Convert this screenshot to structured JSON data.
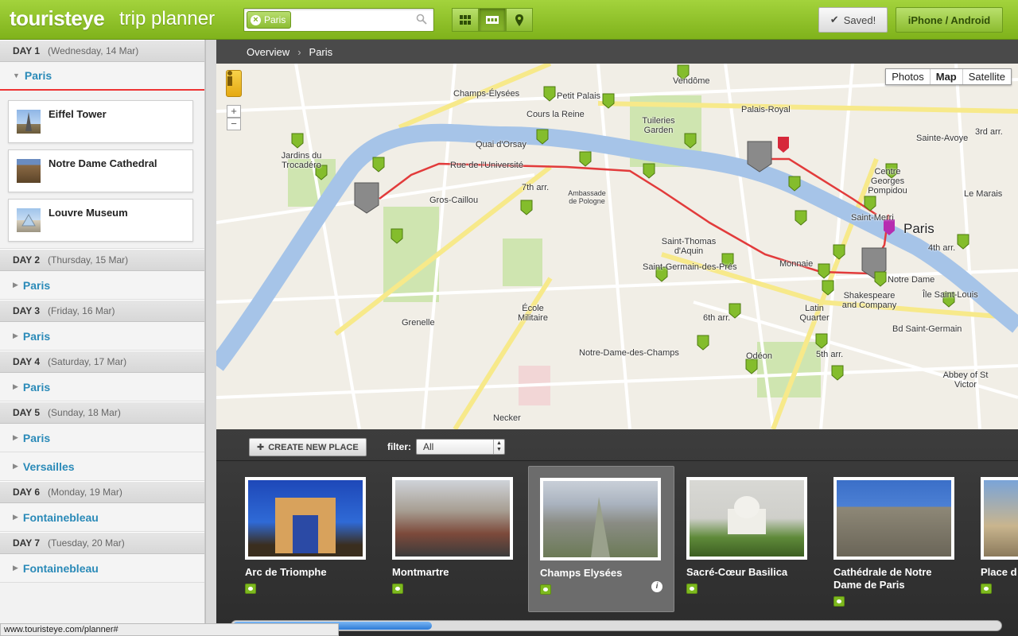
{
  "header": {
    "logo": "touristeye",
    "subtitle": "trip planner",
    "search_chip": "Paris",
    "saved_label": "Saved!",
    "platform_label": "iPhone / Android",
    "colors": {
      "brand_green": "#8cbc30",
      "link_blue": "#2a8ab8",
      "route_red": "#e23b3b"
    }
  },
  "sidebar": {
    "days": [
      {
        "label": "DAY 1",
        "date": "(Wednesday, 14 Mar)",
        "cities": [
          {
            "name": "Paris",
            "expanded": true,
            "places": [
              "Eiffel Tower",
              "Notre Dame Cathedral",
              "Louvre Museum"
            ]
          }
        ]
      },
      {
        "label": "DAY 2",
        "date": "(Thursday, 15 Mar)",
        "cities": [
          {
            "name": "Paris",
            "expanded": false
          }
        ]
      },
      {
        "label": "DAY 3",
        "date": "(Friday, 16 Mar)",
        "cities": [
          {
            "name": "Paris",
            "expanded": false
          }
        ]
      },
      {
        "label": "DAY 4",
        "date": "(Saturday, 17 Mar)",
        "cities": [
          {
            "name": "Paris",
            "expanded": false
          }
        ]
      },
      {
        "label": "DAY 5",
        "date": "(Sunday, 18 Mar)",
        "cities": [
          {
            "name": "Paris",
            "expanded": false
          },
          {
            "name": "Versailles",
            "expanded": false
          }
        ]
      },
      {
        "label": "DAY 6",
        "date": "(Monday, 19 Mar)",
        "cities": [
          {
            "name": "Fontainebleau",
            "expanded": false
          }
        ]
      },
      {
        "label": "DAY 7",
        "date": "(Tuesday, 20 Mar)",
        "cities": [
          {
            "name": "Fontainebleau",
            "expanded": false
          }
        ]
      }
    ]
  },
  "breadcrumb": {
    "items": [
      "Overview",
      "Paris"
    ]
  },
  "map": {
    "type_buttons": [
      "Photos",
      "Map",
      "Satellite"
    ],
    "active_type": "Map",
    "labels": {
      "paris": "Paris",
      "champs": "Champs-Élysées",
      "petit_palais": "Petit Palais",
      "tuileries": "Tuileries Garden",
      "palais_royal": "Palais-Royal",
      "gros_caillou": "Gros-Caillou",
      "seventh": "7th arr.",
      "grenelle": "Grenelle",
      "ecole": "École Militaire",
      "notre_dame": "Notre Dame",
      "odeon": "Odéon",
      "sixth": "6th arr.",
      "fifth": "5th arr.",
      "fourth": "4th arr.",
      "third": "3rd arr.",
      "monnaie": "Monnaie",
      "latin": "Latin Quarter",
      "necker": "Necker",
      "ndchamps": "Notre-Dame-des-Champs",
      "st_thomas": "Saint-Thomas d'Aquin",
      "st_germain": "Saint-Germain-des-Prés",
      "sainte_avoye": "Sainte-Avoye",
      "jardins_troc": "Jardins du Trocadéro",
      "quai_orsay": "Quai d'Orsay",
      "rue_univ": "Rue de l'Université",
      "cours_reine": "Cours la Reine",
      "abbey": "Abbey of St Victor",
      "shakespeare": "Shakespeare and Company",
      "centre_pompidou": "Centre Georges Pompidou",
      "ile_st_louis": "Île Saint-Louis",
      "bd_st_germain": "Bd Saint-Germain",
      "vendome": "Vendôme",
      "ambassade": "Ambassade de Pologne",
      "saint_merri": "Saint-Merri",
      "marais": "Le Marais"
    }
  },
  "bottom": {
    "create_label": "CREATE NEW PLACE",
    "filter_label": "filter:",
    "filter_value": "All",
    "cards": [
      {
        "title": "Arc de Triomphe",
        "selected": false
      },
      {
        "title": "Montmartre",
        "selected": false
      },
      {
        "title": "Champs Elysées",
        "selected": true
      },
      {
        "title": "Sacré-Cœur Basilica",
        "selected": false
      },
      {
        "title": "Cathédrale de Notre Dame de Paris",
        "selected": false
      },
      {
        "title": "Place d",
        "selected": false
      }
    ]
  },
  "status": {
    "url": "www.touristeye.com/planner#"
  }
}
